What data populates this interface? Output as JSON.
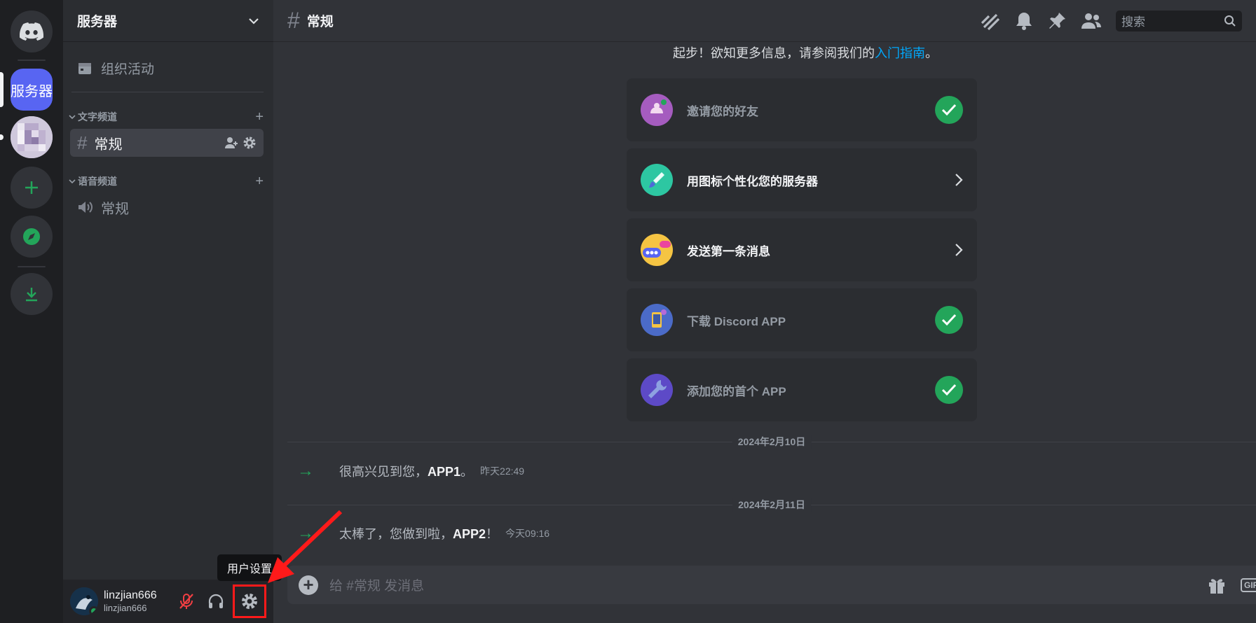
{
  "rail": {
    "active_server_label": "服务器"
  },
  "sidebar": {
    "server_name": "服务器",
    "events_label": "组织活动",
    "text_category": "文字频道",
    "voice_category": "语音频道",
    "text_channel": "常规",
    "voice_channel": "常规"
  },
  "user": {
    "display_name": "linzjian666",
    "username": "linzjian666",
    "settings_tooltip": "用户设置"
  },
  "header": {
    "channel_name": "常规",
    "search_placeholder": "搜索"
  },
  "welcome": {
    "intro_text": "起步！欲知更多信息，请参阅我们的",
    "intro_link": "入门指南",
    "intro_end": "。"
  },
  "checklist": [
    {
      "label": "邀请您的好友",
      "done": true
    },
    {
      "label": "用图标个性化您的服务器",
      "done": false
    },
    {
      "label": "发送第一条消息",
      "done": false
    },
    {
      "label": "下载 Discord APP",
      "done": true
    },
    {
      "label": "添加您的首个 APP",
      "done": true
    }
  ],
  "messages": [
    {
      "date": "2024年2月10日",
      "text": "很高兴见到您，",
      "name": "APP1",
      "end": "。",
      "time": "昨天22:49"
    },
    {
      "date": "2024年2月11日",
      "text": "太棒了，您做到啦，",
      "name": "APP2",
      "end": "！",
      "time": "今天09:16"
    }
  ],
  "composer": {
    "placeholder": "给 #常规 发消息",
    "gif_label": "GIF"
  },
  "colors": {
    "blurple": "#5865f2",
    "green": "#23a55a",
    "link": "#00a8fc",
    "annotation_red": "#ff1a1a"
  }
}
